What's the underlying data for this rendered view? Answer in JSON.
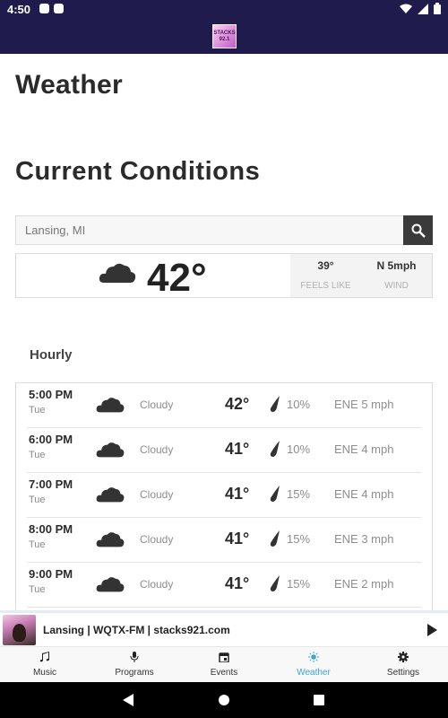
{
  "status_bar": {
    "time": "4:50"
  },
  "app_bar": {
    "logo_text": "STACKS 92.1"
  },
  "page": {
    "title": "Weather"
  },
  "current": {
    "section_title": "Current Conditions",
    "search_placeholder": "Lansing, MI",
    "temperature": "42°",
    "condition_icon": "cloud-icon",
    "feels_like_value": "39°",
    "feels_like_label": "FEELS LIKE",
    "wind_value": "N 5mph",
    "wind_label": "WIND"
  },
  "hourly": {
    "title": "Hourly",
    "rows": [
      {
        "time": "5:00 PM",
        "day": "Tue",
        "condition": "Cloudy",
        "temp": "42°",
        "precip": "10%",
        "wind": "ENE 5 mph"
      },
      {
        "time": "6:00 PM",
        "day": "Tue",
        "condition": "Cloudy",
        "temp": "41°",
        "precip": "10%",
        "wind": "ENE 4 mph"
      },
      {
        "time": "7:00 PM",
        "day": "Tue",
        "condition": "Cloudy",
        "temp": "41°",
        "precip": "15%",
        "wind": "ENE 4 mph"
      },
      {
        "time": "8:00 PM",
        "day": "Tue",
        "condition": "Cloudy",
        "temp": "41°",
        "precip": "15%",
        "wind": "ENE 3 mph"
      },
      {
        "time": "9:00 PM",
        "day": "Tue",
        "condition": "Cloudy",
        "temp": "41°",
        "precip": "15%",
        "wind": "ENE 2 mph"
      }
    ]
  },
  "player": {
    "title": "Lansing | WQTX-FM | stacks921.com"
  },
  "tabs": [
    {
      "label": "Music",
      "icon": "music-note-icon"
    },
    {
      "label": "Programs",
      "icon": "microphone-icon"
    },
    {
      "label": "Events",
      "icon": "calendar-icon"
    },
    {
      "label": "Weather",
      "icon": "sun-icon",
      "active": true
    },
    {
      "label": "Settings",
      "icon": "gear-icon"
    }
  ],
  "colors": {
    "header": "#1f1b4d",
    "active_tab": "#3ba5d9",
    "search_button": "#3a3a3a"
  }
}
